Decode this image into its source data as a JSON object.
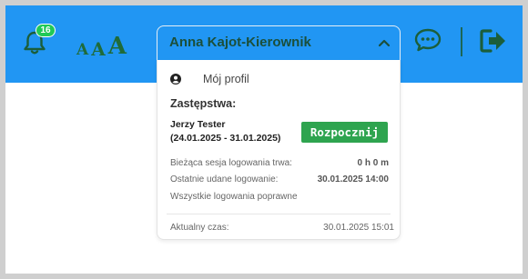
{
  "notifications": {
    "count": "16"
  },
  "font_size": {
    "small": "A",
    "medium": "A",
    "large": "A"
  },
  "user": {
    "name": "Anna Kajot-Kierownik"
  },
  "menu": {
    "profile_label": "Mój profil",
    "substitutions_title": "Zastępstwa:",
    "substitution": {
      "person": "Jerzy Tester",
      "dates": "(24.01.2025 - 31.01.2025)",
      "start_label": "Rozpocznij"
    },
    "session_label": "Bieżąca sesja logowania trwa:",
    "session_value": "0 h 0 m",
    "last_login_label": "Ostatnie udane logowanie:",
    "last_login_value": "30.01.2025 14:00",
    "all_logins_label": "Wszystkie logowania poprawne",
    "current_time_label": "Aktualny czas:",
    "current_time_value": "30.01.2025 15:01"
  },
  "colors": {
    "header": "#2196f3",
    "icon_green": "#1b5e3a",
    "badge": "#20c956",
    "button": "#2ea44f"
  }
}
